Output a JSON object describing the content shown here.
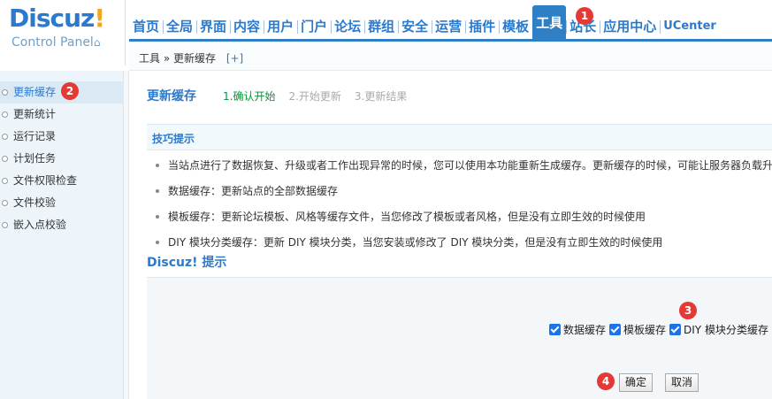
{
  "header": {
    "logo": {
      "name": "Discuz",
      "bang": "!",
      "sub": "Control Panel",
      "home_glyph": "⌂"
    },
    "nav": [
      {
        "label": "首页"
      },
      {
        "label": "全局"
      },
      {
        "label": "界面"
      },
      {
        "label": "内容"
      },
      {
        "label": "用户"
      },
      {
        "label": "门户"
      },
      {
        "label": "论坛"
      },
      {
        "label": "群组"
      },
      {
        "label": "安全"
      },
      {
        "label": "运营"
      },
      {
        "label": "插件"
      },
      {
        "label": "模板"
      },
      {
        "label": "工具",
        "active": true
      },
      {
        "label": "站长"
      },
      {
        "label": "应用中心"
      },
      {
        "label": "UCenter"
      }
    ],
    "breadcrumb": {
      "text": "工具 » 更新缓存",
      "add": "[+]"
    }
  },
  "sidebar": {
    "items": [
      {
        "label": "更新缓存",
        "active": true
      },
      {
        "label": "更新统计"
      },
      {
        "label": "运行记录"
      },
      {
        "label": "计划任务"
      },
      {
        "label": "文件权限检查"
      },
      {
        "label": "文件校验"
      },
      {
        "label": "嵌入点校验"
      }
    ]
  },
  "main": {
    "title": "更新缓存",
    "steps": [
      "1.确认开始",
      "2.开始更新",
      "3.更新结果"
    ],
    "tips_title": "技巧提示",
    "tips": [
      "当站点进行了数据恢复、升级或者工作出现异常的时候，您可以使用本功能重新生成缓存。更新缓存的时候，可能让服务器负载升",
      "数据缓存：更新站点的全部数据缓存",
      "模板缓存：更新论坛模板、风格等缓存文件，当您修改了模板或者风格，但是没有立即生效的时候使用",
      "DIY 模块分类缓存：更新 DIY 模块分类，当您安装或修改了 DIY 模块分类，但是没有立即生效的时候使用"
    ],
    "section_title": "Discuz! 提示",
    "checkboxes": [
      {
        "label": "数据缓存",
        "checked": true
      },
      {
        "label": "模板缓存",
        "checked": true
      },
      {
        "label": "DIY 模块分类缓存",
        "checked": true
      }
    ],
    "confirm_label": "确定",
    "cancel_label": "取消"
  },
  "markers": [
    "1",
    "2",
    "3",
    "4"
  ],
  "colors": {
    "accent": "#2b7acd",
    "active_tab": "#2e7fc5",
    "step_current": "#009933",
    "marker": "#e53935"
  }
}
